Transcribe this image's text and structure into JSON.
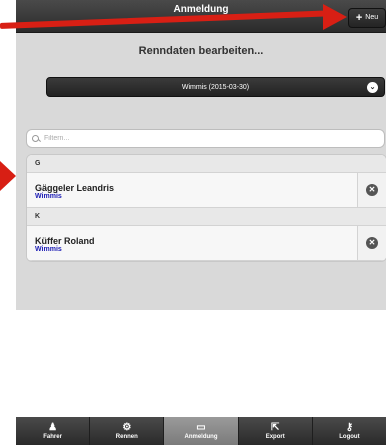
{
  "header": {
    "title": "Anmeldung",
    "new_icon": "plus-icon",
    "new_label": "Neu"
  },
  "page": {
    "title": "Renndaten bearbeiten..."
  },
  "race_select": {
    "value": "Wimmis (2015-03-30)",
    "icon": "chevron-down-icon"
  },
  "filter": {
    "placeholder": "Filtern...",
    "icon": "search-icon"
  },
  "list": {
    "groups": [
      {
        "letter": "G",
        "entries": [
          {
            "name": "Gäggeler Leandris",
            "club": "Wimmis"
          }
        ]
      },
      {
        "letter": "K",
        "entries": [
          {
            "name": "Küffer Roland",
            "club": "Wimmis"
          }
        ]
      }
    ],
    "delete_icon": "close-circle-icon"
  },
  "tabs": [
    {
      "label": "Fahrer",
      "icon": "rider-icon",
      "active": false
    },
    {
      "label": "Rennen",
      "icon": "gear-icon",
      "active": false
    },
    {
      "label": "Anmeldung",
      "icon": "inbox-icon",
      "active": true
    },
    {
      "label": "Export",
      "icon": "export-icon",
      "active": false
    },
    {
      "label": "Logout",
      "icon": "key-icon",
      "active": false
    }
  ],
  "colors": {
    "annotation_arrow": "#d81f14",
    "club_text": "#1a1ab4",
    "active_tab": "#8a8a8a"
  }
}
